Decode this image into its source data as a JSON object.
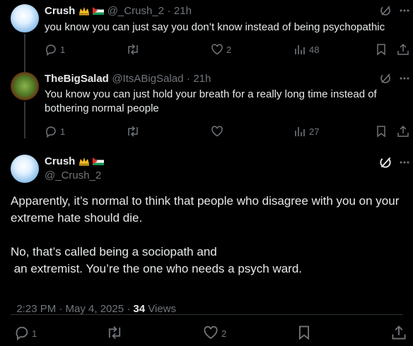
{
  "colors": {
    "background": "#000000",
    "text": "#e7e9ea",
    "muted": "#71767b",
    "line": "#2f3336",
    "flag_green": "#149954",
    "flag_red": "#e4312b",
    "crown": "#f5b921"
  },
  "tweet1": {
    "name": "Crush",
    "handle": "@_Crush_2",
    "sep": "·",
    "time": "21h",
    "text": "you know you can just say you don’t know instead of being psychopathic",
    "replies": "1",
    "retweets": "",
    "likes": "2",
    "views": "48"
  },
  "tweet2": {
    "name": "TheBigSalad",
    "handle": "@ItsABigSalad",
    "sep": "·",
    "time": "21h",
    "text": "You know you can just hold your breath for a really long time instead of bothering normal people",
    "replies": "1",
    "retweets": "",
    "likes": "",
    "views": "27"
  },
  "main": {
    "name": "Crush",
    "handle": "@_Crush_2",
    "para1": "Apparently, it’s normal to think that people who disagree with you on your extreme hate should die.",
    "para2_line1": "No, that’s called being a sociopath and",
    "para2_line2": " an extremist. You’re the one who needs a psych ward.",
    "meta_time": "2:23 PM · May 4, 2025 · ",
    "meta_views_count": "34",
    "meta_views_label": " Views",
    "replies": "1",
    "retweets": "",
    "likes": "2"
  },
  "icons": [
    "grok-icon",
    "more-icon",
    "reply-icon",
    "retweet-icon",
    "like-icon",
    "views-icon",
    "bookmark-icon",
    "share-icon"
  ]
}
